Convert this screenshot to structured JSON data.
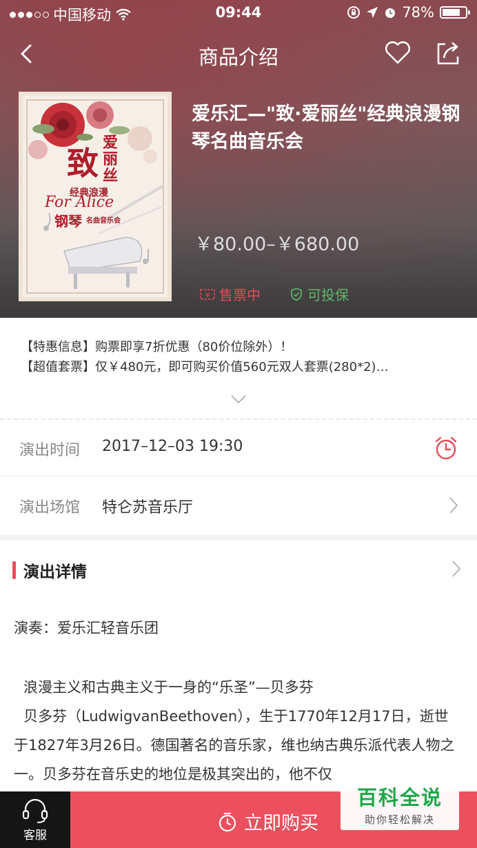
{
  "status_bar": {
    "carrier": "中国移动",
    "time": "09:44",
    "battery_percent": "78%",
    "battery_level": 0.78
  },
  "navbar": {
    "title": "商品介绍",
    "icons": [
      "back-arrow-icon",
      "heart-icon",
      "share-icon"
    ]
  },
  "product": {
    "title": "爱乐汇—\"致·爱丽丝\"经典浪漫钢琴名曲音乐会",
    "price": "￥80.00–￥680.00",
    "poster": {
      "main_char": "致",
      "title_chars": "爱丽丝",
      "subtitle": "经典浪漫",
      "script_text": "For Alice",
      "bottom_main": "钢琴",
      "bottom_sub": "名曲音乐会"
    },
    "tags": {
      "sale_label": "售票中",
      "insure_label": "可投保"
    }
  },
  "promo": {
    "line1": "【特惠信息】购票即享7折优惠（80价位除外）！",
    "line2": "【超值套票】仅￥480元，即可购买价值560元双人套票(280*2)…"
  },
  "info": {
    "time_label": "演出时间",
    "time_value": "2017–12–03 19:30",
    "venue_label": "演出场馆",
    "venue_value": "特仑苏音乐厅"
  },
  "details": {
    "section_title": "演出详情",
    "performer": "演奏：爱乐汇轻音乐团",
    "para1": "浪漫主义和古典主义于一身的“乐圣”—贝多芬",
    "para2": "贝多芬（LudwigvanBeethoven），生于1770年12月17日，逝世于1827年3月26日。德国著名的音乐家，维也纳古典乐派代表人物之一。贝多芬在音乐史的地位是极其突出的，他不仅"
  },
  "bottom_bar": {
    "service_label": "客服",
    "buy_label": "立即购买"
  },
  "watermark": {
    "main": "百科全说",
    "sub": "助你轻松解决"
  },
  "colors": {
    "accent": "#ec4f5e",
    "insure_green": "#5cb86a",
    "watermark_green": "#1fa84a"
  }
}
